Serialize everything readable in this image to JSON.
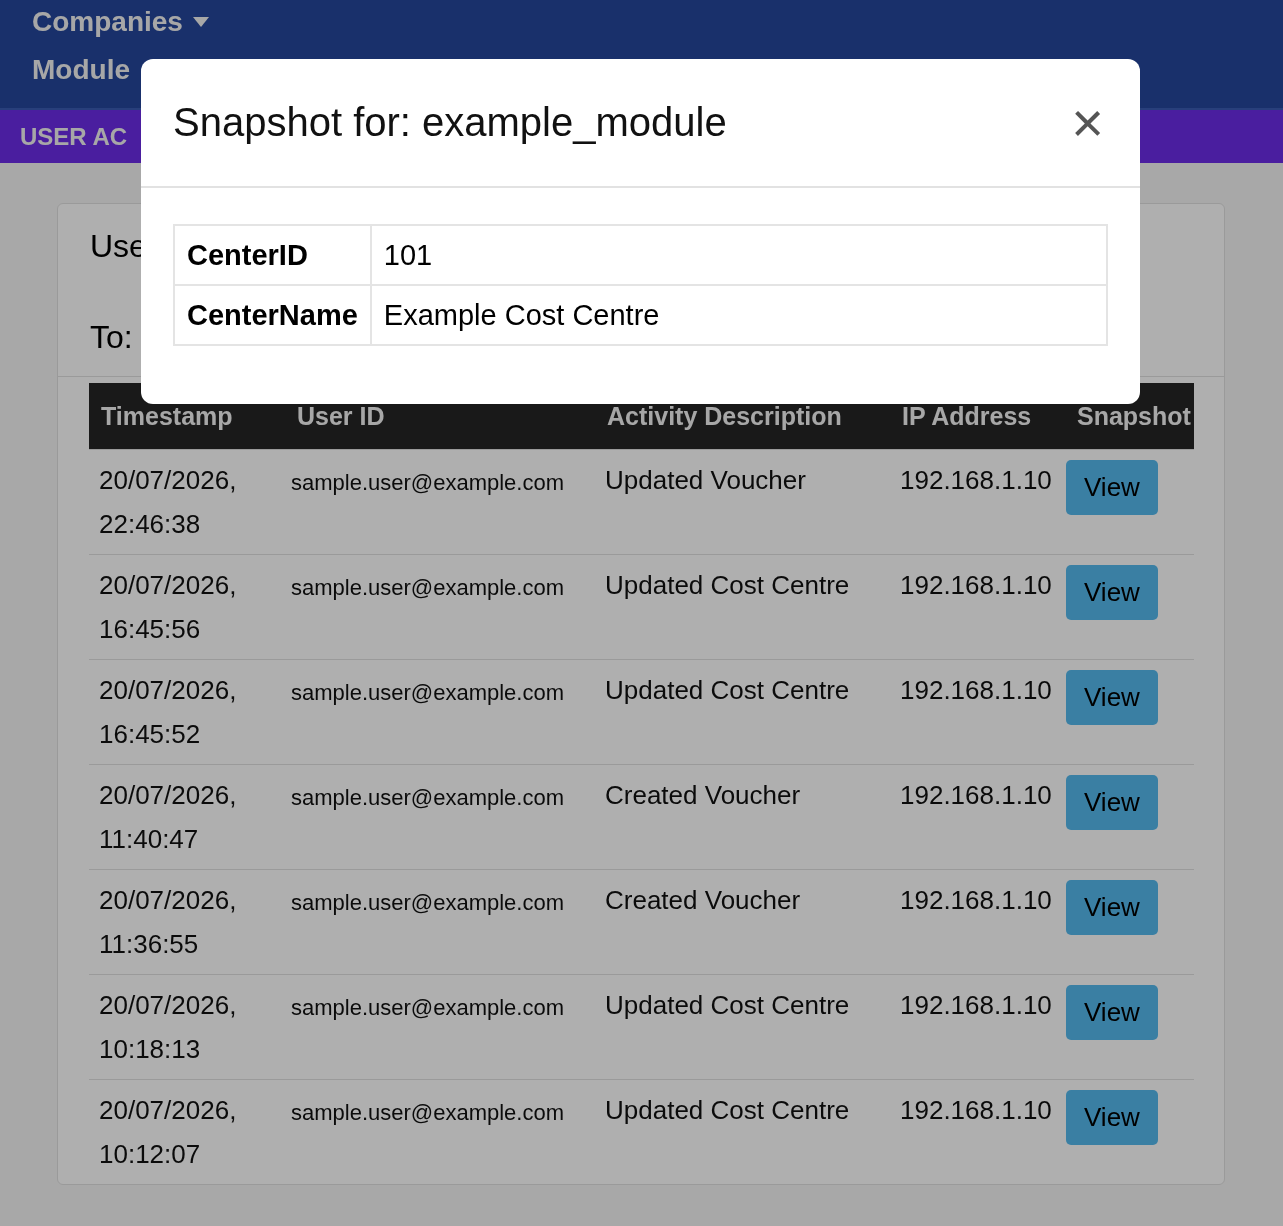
{
  "navbar": {
    "items": [
      {
        "label": "Companies",
        "dropdown": true
      },
      {
        "label": "Module",
        "dropdown": false
      }
    ]
  },
  "section_bar": {
    "title": "USER AC"
  },
  "filters": {
    "labels": [
      "Use",
      "To:"
    ]
  },
  "table": {
    "columns": [
      "Timestamp",
      "User ID",
      "Activity Description",
      "IP Address",
      "Snapshot"
    ],
    "rows": [
      {
        "timestamp": "20/07/2026, 22:46:38",
        "user": "sample.user@example.com",
        "activity": "Updated Voucher",
        "ip": "192.168.1.10",
        "action": "View"
      },
      {
        "timestamp": "20/07/2026, 16:45:56",
        "user": "sample.user@example.com",
        "activity": "Updated Cost Centre",
        "ip": "192.168.1.10",
        "action": "View"
      },
      {
        "timestamp": "20/07/2026, 16:45:52",
        "user": "sample.user@example.com",
        "activity": "Updated Cost Centre",
        "ip": "192.168.1.10",
        "action": "View"
      },
      {
        "timestamp": "20/07/2026, 11:40:47",
        "user": "sample.user@example.com",
        "activity": "Created Voucher",
        "ip": "192.168.1.10",
        "action": "View"
      },
      {
        "timestamp": "20/07/2026, 11:36:55",
        "user": "sample.user@example.com",
        "activity": "Created Voucher",
        "ip": "192.168.1.10",
        "action": "View"
      },
      {
        "timestamp": "20/07/2026, 10:18:13",
        "user": "sample.user@example.com",
        "activity": "Updated Cost Centre",
        "ip": "192.168.1.10",
        "action": "View"
      },
      {
        "timestamp": "20/07/2026, 10:12:07",
        "user": "sample.user@example.com",
        "activity": "Updated Cost Centre",
        "ip": "192.168.1.10",
        "action": "View"
      }
    ]
  },
  "modal": {
    "title": "Snapshot for: example_module",
    "close": "×",
    "fields": [
      {
        "key": "CenterID",
        "value": "101"
      },
      {
        "key": "CenterName",
        "value": "Example Cost Centre"
      }
    ]
  }
}
